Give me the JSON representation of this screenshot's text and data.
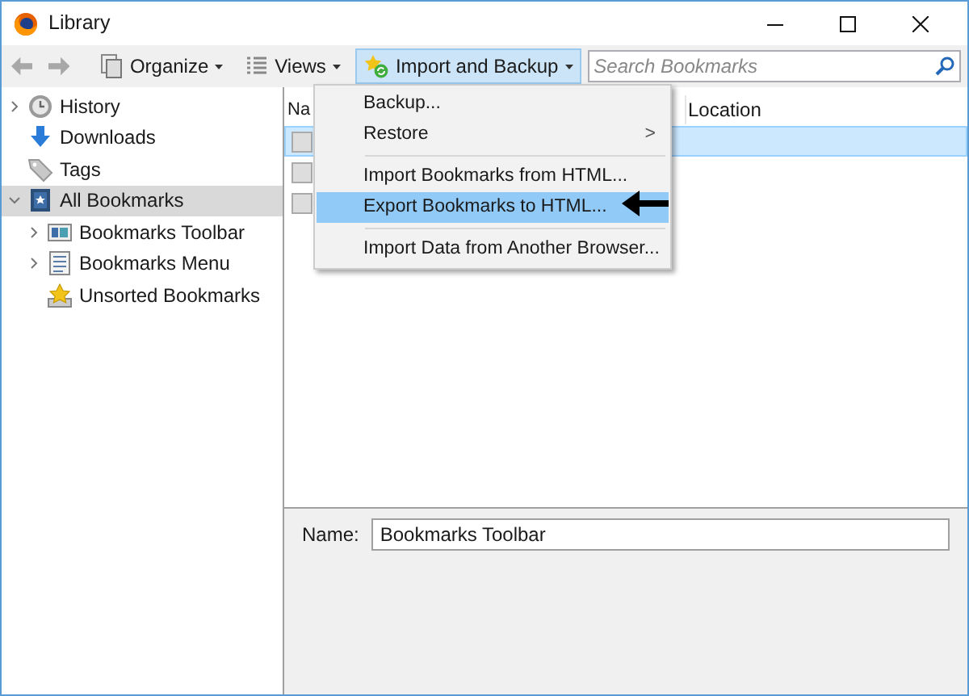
{
  "window": {
    "title": "Library"
  },
  "toolbar": {
    "buttons": [
      {
        "label": "Organize",
        "selected": false
      },
      {
        "label": "Views",
        "selected": false
      },
      {
        "label": "Import and Backup",
        "selected": true
      }
    ],
    "search": {
      "placeholder": "Search Bookmarks"
    }
  },
  "sidebar": {
    "items": [
      {
        "label": "History",
        "expanded": false,
        "selected": false
      },
      {
        "label": "Downloads",
        "selected": false
      },
      {
        "label": "Tags",
        "selected": false
      },
      {
        "label": "All Bookmarks",
        "expanded": true,
        "selected": true,
        "children": [
          {
            "label": "Bookmarks Toolbar",
            "expanded": false,
            "selected": false
          },
          {
            "label": "Bookmarks Menu",
            "expanded": false,
            "selected": false
          },
          {
            "label": "Unsorted Bookmarks",
            "selected": false
          }
        ]
      }
    ]
  },
  "table": {
    "columns": [
      "Na",
      "Location"
    ],
    "rows": [
      {
        "selected": true
      },
      {
        "selected": false
      },
      {
        "selected": false
      }
    ]
  },
  "menu": {
    "items": [
      {
        "kind": "item",
        "label": "Backup...",
        "selected": false
      },
      {
        "kind": "submenu",
        "label": "Restore",
        "arrow": ">",
        "selected": false
      },
      {
        "kind": "separator"
      },
      {
        "kind": "item",
        "label": "Import Bookmarks from HTML...",
        "selected": false
      },
      {
        "kind": "item",
        "label": "Export Bookmarks to HTML...",
        "selected": true
      },
      {
        "kind": "separator"
      },
      {
        "kind": "item",
        "label": "Import Data from Another Browser...",
        "selected": false
      }
    ]
  },
  "details": {
    "label": "Name:",
    "value": "Bookmarks Toolbar"
  }
}
